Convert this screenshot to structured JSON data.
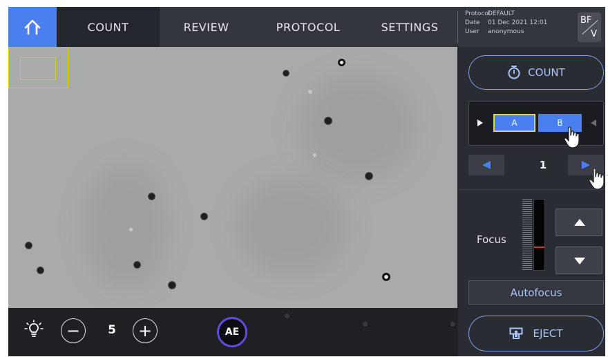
{
  "nav": {
    "home_icon": "home-icon",
    "tabs": [
      {
        "label": "COUNT",
        "active": true
      },
      {
        "label": "REVIEW",
        "active": false
      },
      {
        "label": "PROTOCOL",
        "active": false
      },
      {
        "label": "SETTINGS",
        "active": false
      }
    ]
  },
  "info": {
    "protocol_key": "Protocol",
    "protocol_value": "DEFAULT",
    "date_key": "Date",
    "date_value": "01 Dec 2021 12:01",
    "user_key": "User",
    "user_value": "anonymous"
  },
  "mode_toggle": {
    "top": "BF",
    "bottom": "V"
  },
  "illumination": {
    "icon": "light-bulb-icon",
    "level": "5",
    "minus": "−",
    "plus": "+"
  },
  "ae_button": "AE",
  "panel": {
    "count_label": "COUNT",
    "count_icon": "stopwatch-icon",
    "slot_a": "A",
    "slot_b": "B",
    "page": "1",
    "focus_label": "Focus",
    "autofocus_label": "Autofocus",
    "eject_label": "EJECT",
    "eject_icon": "eject-tray-icon"
  },
  "colors": {
    "accent": "#4a7ff0",
    "accent_text": "#a9c3fb",
    "selection_outline": "#e2dc1a",
    "ae_ring": "#5d4ee0",
    "focus_marker": "#c83a3a"
  }
}
